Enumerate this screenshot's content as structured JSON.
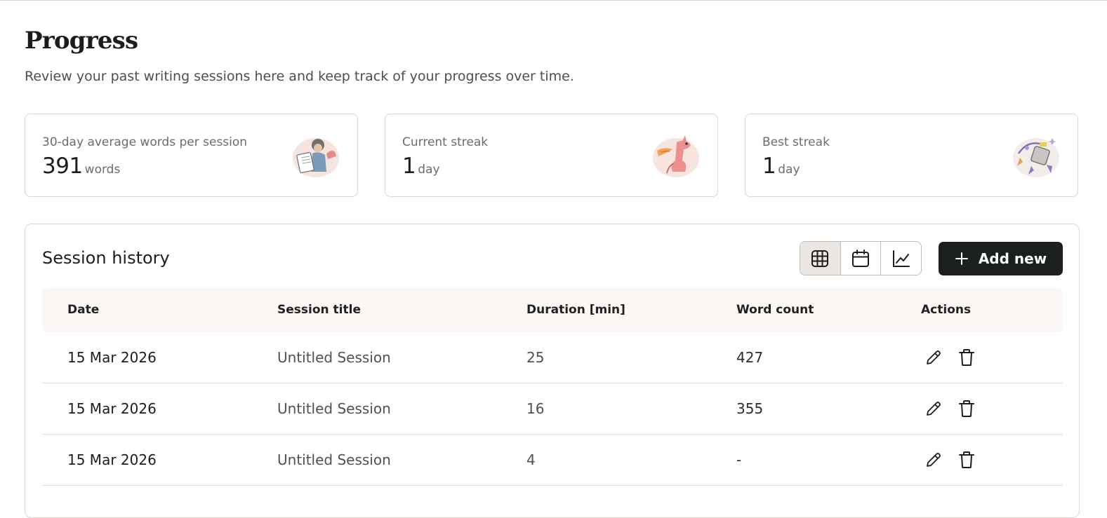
{
  "page": {
    "title": "Progress",
    "subtitle": "Review your past writing sessions here and keep track of your progress over time."
  },
  "stats": [
    {
      "label": "30-day average words per session",
      "value": "391",
      "unit": "words",
      "illustration": "writer-reading-illustration"
    },
    {
      "label": "Current streak",
      "value": "1",
      "unit": "day",
      "illustration": "dragon-illustration"
    },
    {
      "label": "Best streak",
      "value": "1",
      "unit": "day",
      "illustration": "robot-lantern-illustration"
    }
  ],
  "history": {
    "title": "Session history",
    "view_modes": [
      {
        "name": "table-view",
        "icon": "table-icon",
        "active": true
      },
      {
        "name": "calendar-view",
        "icon": "calendar-icon",
        "active": false
      },
      {
        "name": "chart-view",
        "icon": "line-chart-icon",
        "active": false
      }
    ],
    "add_button_label": "Add new",
    "columns": [
      "Date",
      "Session title",
      "Duration [min]",
      "Word count",
      "Actions"
    ],
    "rows": [
      {
        "date": "15 Mar 2026",
        "title": "Untitled Session",
        "duration": "25",
        "words": "427"
      },
      {
        "date": "15 Mar 2026",
        "title": "Untitled Session",
        "duration": "16",
        "words": "355"
      },
      {
        "date": "15 Mar 2026",
        "title": "Untitled Session",
        "duration": "4",
        "words": "-"
      }
    ],
    "row_actions": [
      "edit-icon",
      "delete-icon"
    ]
  },
  "colors": {
    "primary_button": "#1b201f",
    "table_header_bg": "#fcf7f5",
    "active_toggle_bg": "#ebe6e2",
    "border": "#d9d6d3"
  }
}
